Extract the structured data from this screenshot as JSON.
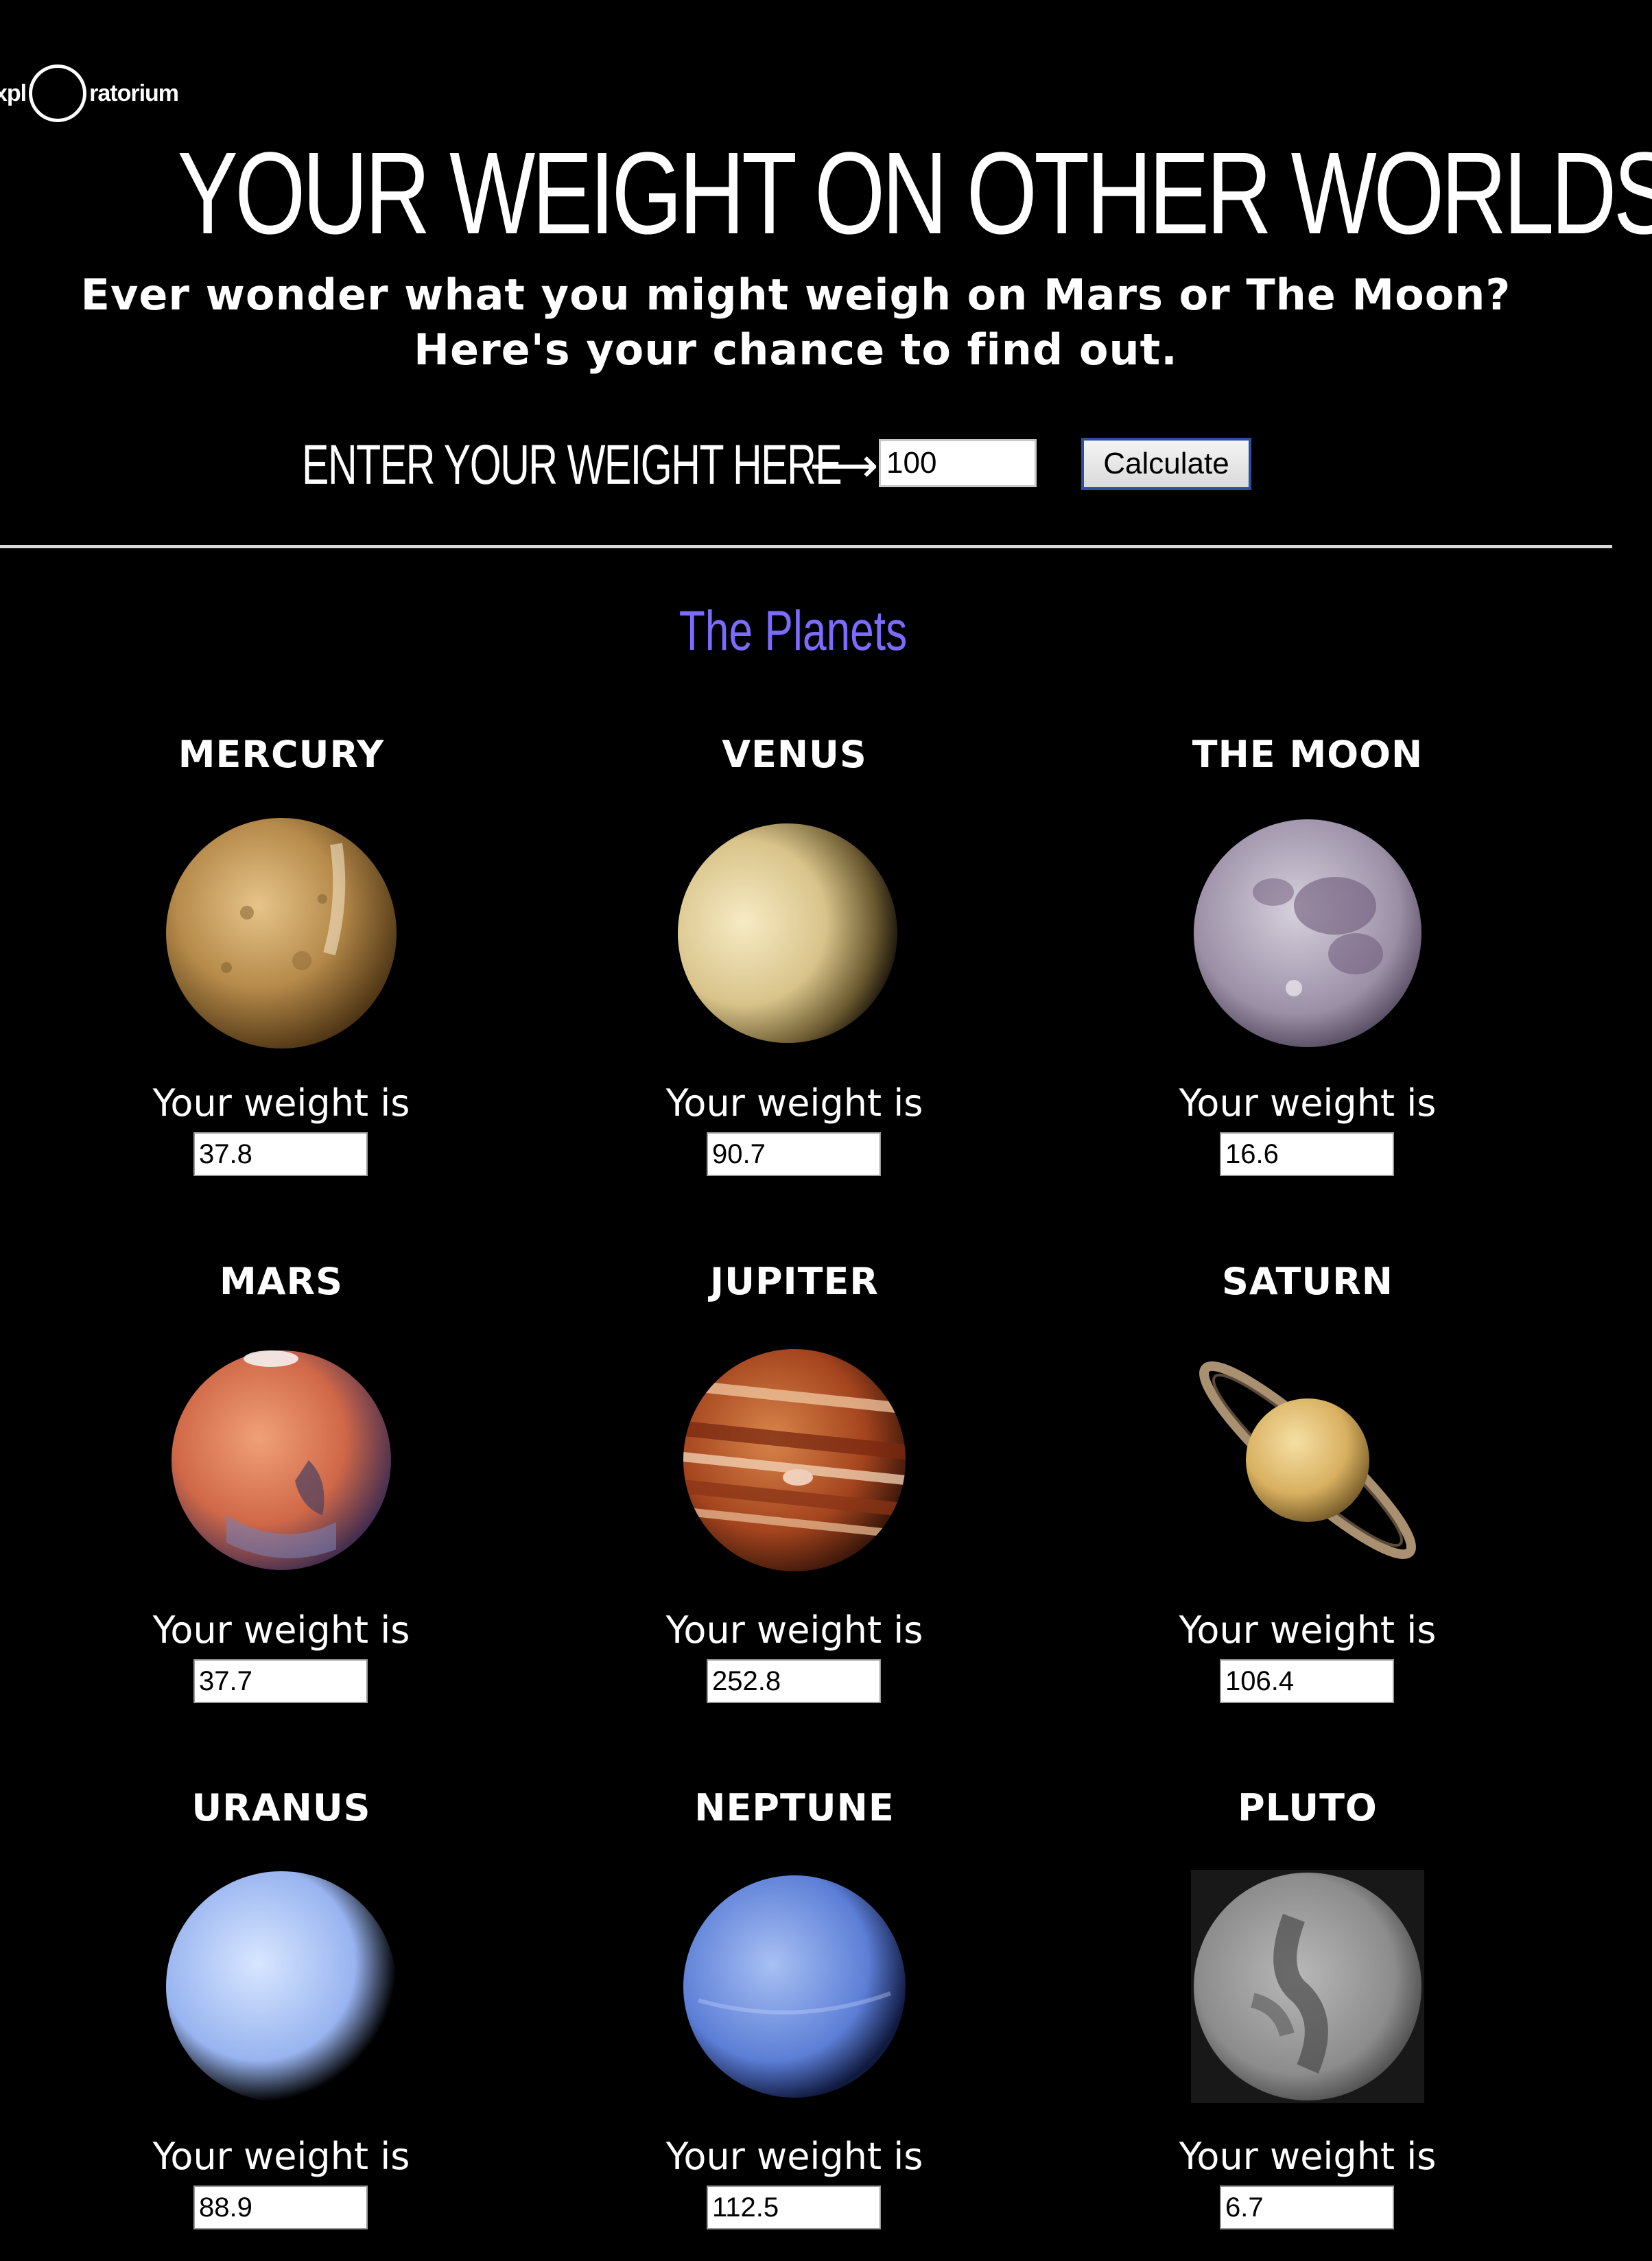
{
  "header": {
    "logo_prefix": "xpl",
    "logo_suffix": "ratorium",
    "title": "YOUR WEIGHT ON OTHER WORLDS",
    "subtitle_line1": "Ever wonder what you might weigh on Mars or The Moon?",
    "subtitle_line2": "Here's your chance to find out."
  },
  "entry": {
    "label": "ENTER YOUR WEIGHT HERE",
    "arrow": "⟶",
    "value": "100",
    "button_label": "Calculate"
  },
  "section": {
    "title": "The Planets"
  },
  "colors": {
    "background": "#000000",
    "text": "#ffffff",
    "section_title": "#7b6cff"
  },
  "planets": [
    {
      "name": "MERCURY",
      "label": "Your weight is",
      "weight": "37.8"
    },
    {
      "name": "VENUS",
      "label": "Your weight is",
      "weight": "90.7"
    },
    {
      "name": "THE MOON",
      "label": "Your weight is",
      "weight": "16.6"
    },
    {
      "name": "MARS",
      "label": "Your weight is",
      "weight": "37.7"
    },
    {
      "name": "JUPITER",
      "label": "Your weight is",
      "weight": "252.8"
    },
    {
      "name": "SATURN",
      "label": "Your weight is",
      "weight": "106.4"
    },
    {
      "name": "URANUS",
      "label": "Your weight is",
      "weight": "88.9"
    },
    {
      "name": "NEPTUNE",
      "label": "Your weight is",
      "weight": "112.5"
    },
    {
      "name": "PLUTO",
      "label": "Your weight is",
      "weight": "6.7"
    }
  ]
}
